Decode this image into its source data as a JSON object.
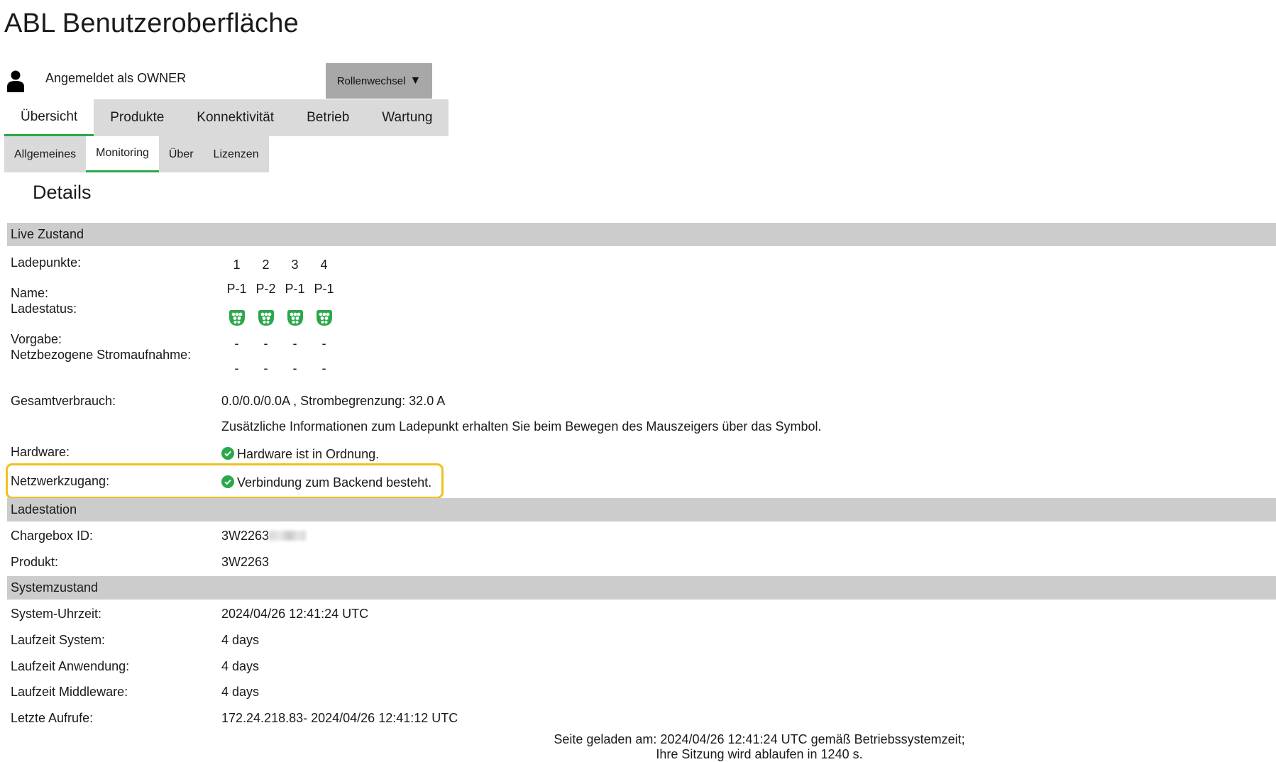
{
  "app": {
    "title": "ABL Benutzeroberfläche"
  },
  "user": {
    "label": "Angemeldet als OWNER",
    "icon": "user-icon"
  },
  "role_switch": {
    "label": "Rollenwechsel",
    "icon": "triangle-down-icon"
  },
  "main_tabs": [
    {
      "label": "Übersicht",
      "active": true
    },
    {
      "label": "Produkte",
      "active": false
    },
    {
      "label": "Konnektivität",
      "active": false
    },
    {
      "label": "Betrieb",
      "active": false
    },
    {
      "label": "Wartung",
      "active": false
    }
  ],
  "sub_tabs": [
    {
      "label": "Allgemeines",
      "active": false
    },
    {
      "label": "Monitoring",
      "active": true
    },
    {
      "label": "Über",
      "active": false
    },
    {
      "label": "Lizenzen",
      "active": false
    }
  ],
  "accent_color": "#2aa84a",
  "highlight_color": "#f0c020",
  "details_title": "Details",
  "live": {
    "section_title": "Live Zustand",
    "ladepunkte_label": "Ladepunkte:",
    "ladepunkte": [
      "1",
      "2",
      "3",
      "4"
    ],
    "name_label": "Name:",
    "names": [
      "P-1",
      "P-2",
      "P-1",
      "P-1"
    ],
    "ladestatus_label": "Ladestatus:",
    "ladestatus_icon": "charging-connector-icon",
    "vorgabe_label": "Vorgabe:",
    "vorgabe": [
      "-",
      "-",
      "-",
      "-"
    ],
    "netz_label": "Netzbezogene Stromaufnahme:",
    "netz": [
      "-",
      "-",
      "-",
      "-"
    ],
    "gesamt_label": "Gesamtverbrauch:",
    "gesamt_value": "0.0/0.0/0.0A , Strombegrenzung: 32.0 A",
    "info_text": "Zusätzliche Informationen zum Ladepunkt erhalten Sie beim Bewegen des Mauszeigers über das Symbol.",
    "hardware_label": "Hardware:",
    "hardware_value": "Hardware ist in Ordnung.",
    "netzwerk_label": "Netzwerkzugang:",
    "netzwerk_value": "Verbindung zum Backend besteht."
  },
  "station": {
    "section_title": "Ladestation",
    "chargebox_label": "Chargebox ID:",
    "chargebox_value": "3W2263",
    "produkt_label": "Produkt:",
    "produkt_value": "3W2263"
  },
  "system": {
    "section_title": "Systemzustand",
    "uhrzeit_label": "System-Uhrzeit:",
    "uhrzeit_value": "2024/04/26 12:41:24 UTC",
    "laufzeit_system_label": "Laufzeit System:",
    "laufzeit_system_value": "4 days",
    "laufzeit_anwendung_label": "Laufzeit Anwendung:",
    "laufzeit_anwendung_value": "4 days",
    "laufzeit_middleware_label": "Laufzeit Middleware:",
    "laufzeit_middleware_value": "4 days",
    "aufrufe_label": "Letzte Aufrufe:",
    "aufrufe_value": "172.24.218.83- 2024/04/26 12:41:12 UTC"
  },
  "footer": {
    "line1": "Seite geladen am: 2024/04/26 12:41:24 UTC gemäß Betriebssystemzeit;",
    "line2": "Ihre Sitzung wird ablaufen in 1240 s."
  }
}
